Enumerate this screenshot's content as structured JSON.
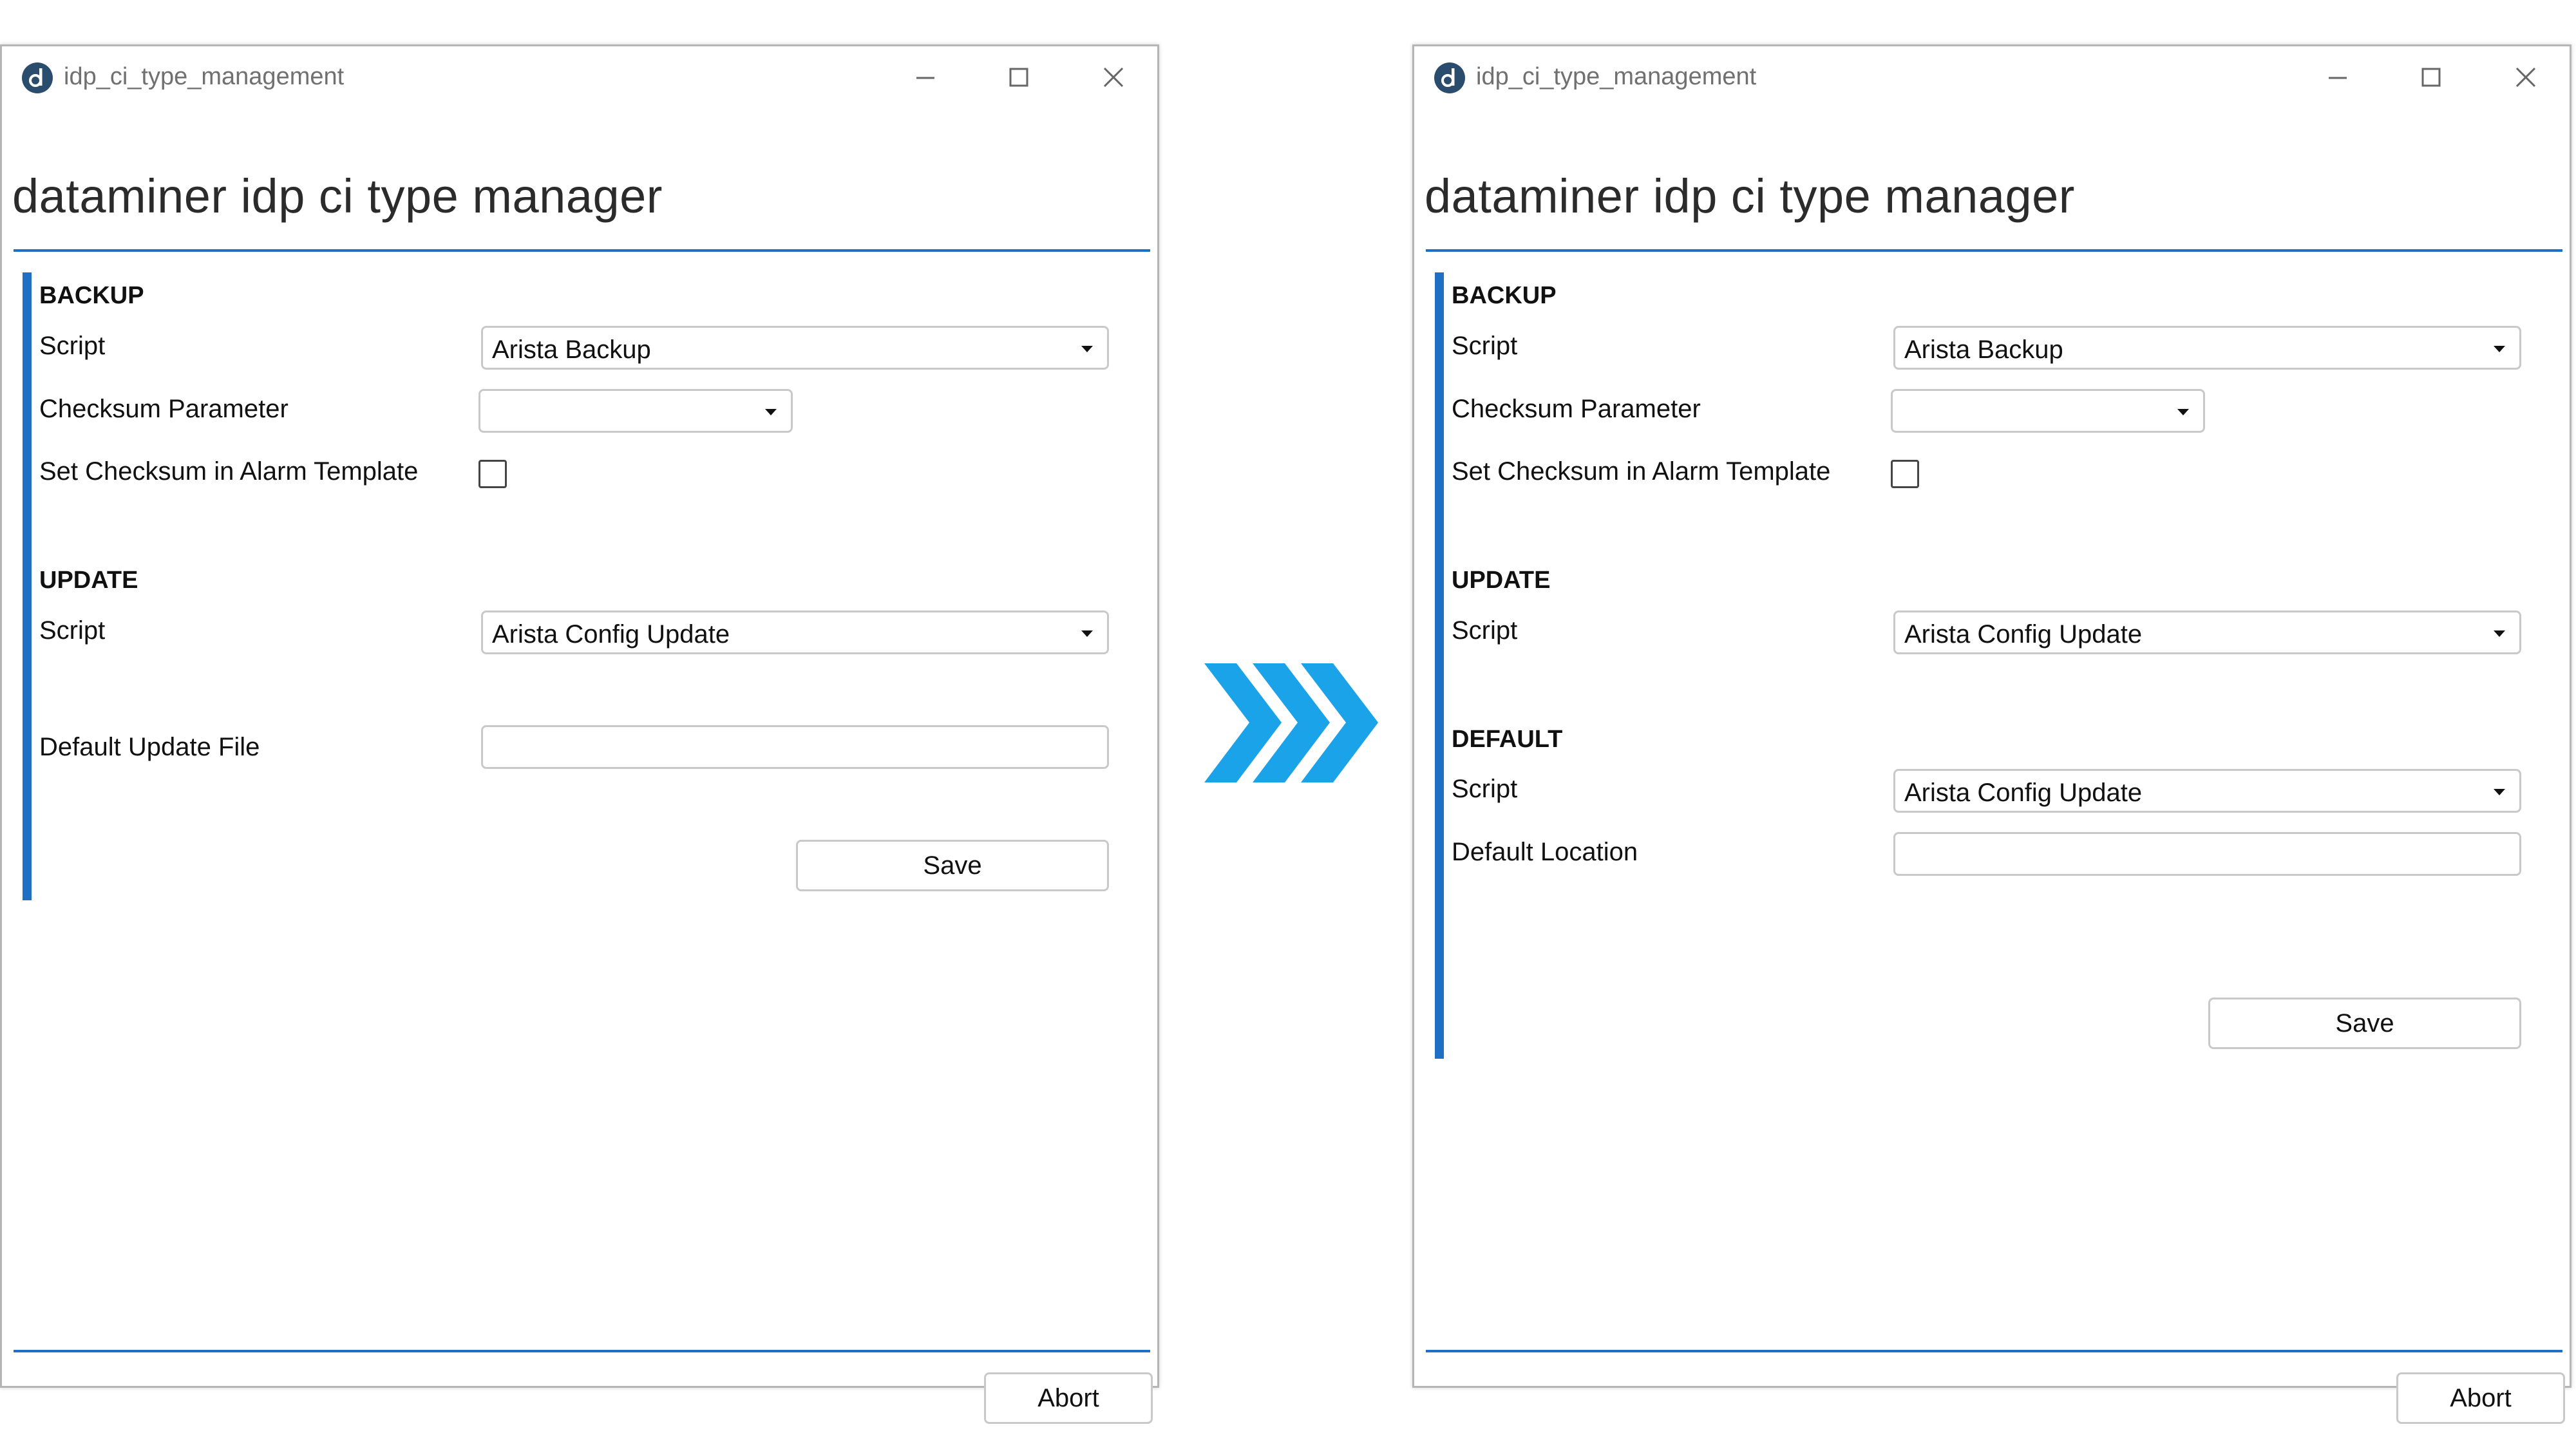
{
  "windows": [
    {
      "title": "idp_ci_type_management",
      "heading": "dataminer idp ci type manager",
      "backup": {
        "section": "BACKUP",
        "script_label": "Script",
        "script_value": "Arista Backup",
        "checksum_label": "Checksum Parameter",
        "checksum_value": "",
        "alarm_label": "Set Checksum in Alarm Template",
        "alarm_checked": false
      },
      "update": {
        "section": "UPDATE",
        "script_label": "Script",
        "script_value": "Arista Config Update",
        "file_label": "Default Update File",
        "file_value": ""
      },
      "save_label": "Save",
      "abort_label": "Abort"
    },
    {
      "title": "idp_ci_type_management",
      "heading": "dataminer idp ci type manager",
      "backup": {
        "section": "BACKUP",
        "script_label": "Script",
        "script_value": "Arista Backup",
        "checksum_label": "Checksum Parameter",
        "checksum_value": "",
        "alarm_label": "Set Checksum in Alarm Template",
        "alarm_checked": false
      },
      "update": {
        "section": "UPDATE",
        "script_label": "Script",
        "script_value": "Arista Config Update"
      },
      "default": {
        "section": "DEFAULT",
        "script_label": "Script",
        "script_value": "Arista Config Update",
        "location_label": "Default Location",
        "location_value": ""
      },
      "save_label": "Save",
      "abort_label": "Abort"
    }
  ],
  "colors": {
    "accent": "#1f6fc5",
    "arrow": "#1aa3e8"
  },
  "icons": {
    "app": "dataminer-logo-icon",
    "minimize": "minimize-icon",
    "maximize": "maximize-icon",
    "close": "close-icon",
    "dropdown": "caret-down-icon",
    "transition": "triple-chevron-right-icon"
  }
}
